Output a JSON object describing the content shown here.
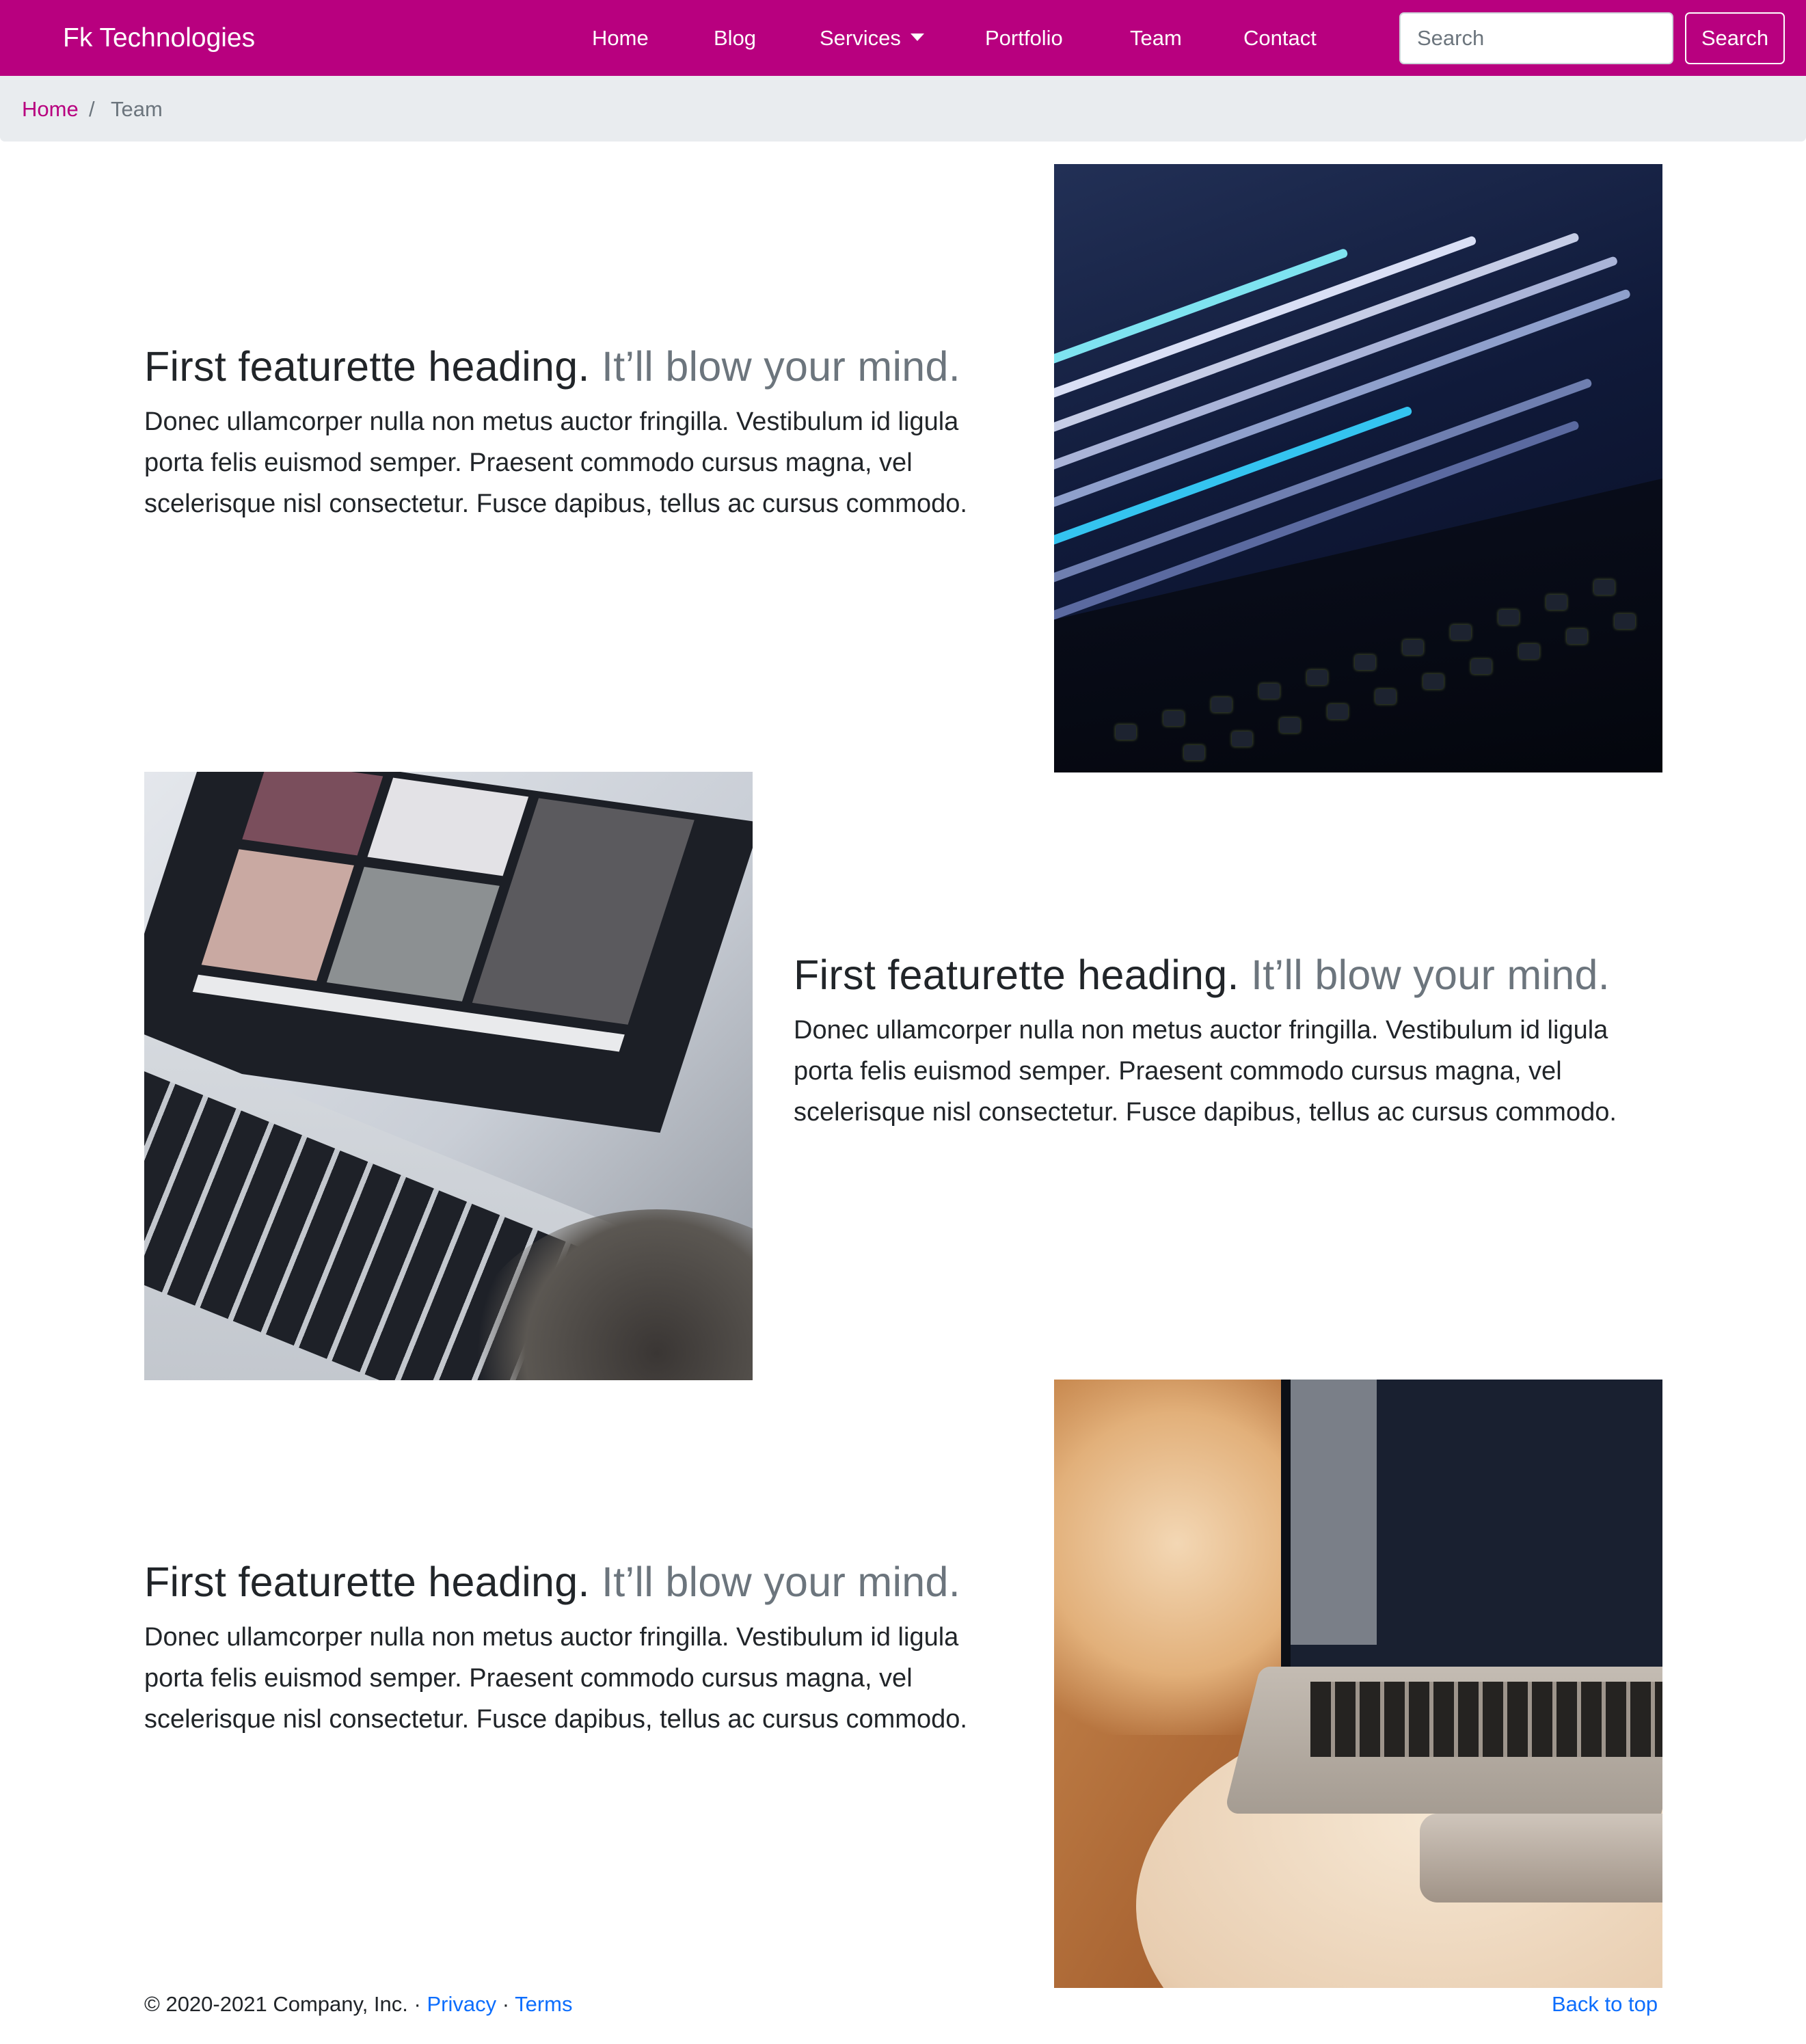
{
  "navbar": {
    "brand": "Fk Technologies",
    "color": "#b8007f",
    "links": [
      {
        "label": "Home"
      },
      {
        "label": "Blog"
      },
      {
        "label": "Services"
      },
      {
        "label": "Portfolio"
      },
      {
        "label": "Team"
      },
      {
        "label": "Contact"
      }
    ],
    "search_placeholder": "Search",
    "search_button": "Search"
  },
  "breadcrumb": {
    "home": "Home",
    "separator": "/",
    "current": "Team"
  },
  "featurettes": [
    {
      "heading": "First featurette heading.",
      "heading_muted": "It’ll blow your mind.",
      "lead": "Donec ullamcorper nulla non metus auctor fringilla. Vestibulum id ligula porta felis euismod semper. Praesent commodo cursus magna, vel scelerisque nisl consectetur. Fusce dapibus, tellus ac cursus commodo.",
      "image": "laptop-code-photo"
    },
    {
      "heading": "First featurette heading.",
      "heading_muted": "It’ll blow your mind.",
      "lead": "Donec ullamcorper nulla non metus auctor fringilla. Vestibulum id ligula porta felis euismod semper. Praesent commodo cursus magna, vel scelerisque nisl consectetur. Fusce dapibus, tellus ac cursus commodo.",
      "image": "laptop-photo-grid-photo"
    },
    {
      "heading": "First featurette heading.",
      "heading_muted": "It’ll blow your mind.",
      "lead": "Donec ullamcorper nulla non metus auctor fringilla. Vestibulum id ligula porta felis euismod semper. Praesent commodo cursus magna, vel scelerisque nisl consectetur. Fusce dapibus, tellus ac cursus commodo.",
      "image": "laptop-on-table-photo"
    }
  ],
  "footer": {
    "copyright": "© 2020-2021 Company, Inc. · ",
    "privacy": "Privacy",
    "dot": " · ",
    "terms": "Terms",
    "back_to_top": "Back to top",
    "link_color": "#0d6efd"
  }
}
